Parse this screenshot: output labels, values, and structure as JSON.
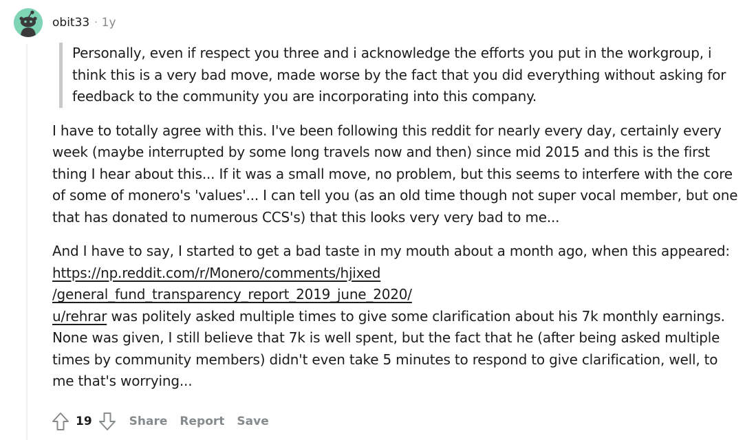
{
  "comment": {
    "username": "obit33",
    "separator": "·",
    "age": "1y",
    "avatar_icon": "snoo-avatar-icon",
    "avatar_color": "#7ed4b5",
    "quote": "Personally, even if respect you three and i acknowledge the efforts you put in the workgroup, i think this is a very bad move, made worse by the fact that you did everything without asking for feedback to the community you are incorporating into this company.",
    "paragraph1": "I have to totally agree with this. I've been following this reddit for nearly every day, certainly every week (maybe interrupted by some long travels now and then) since mid 2015 and this is the first thing I hear about this... If it was a small move, no problem, but this seems to interfere with the core of some of monero's 'values'... I can tell you (as an old time though not super vocal member, but one that has donated to numerous CCS's) that this looks very very bad to me...",
    "paragraph2_intro": "And I have to say, I started to get a bad taste in my mouth about a month ago, when this appeared:",
    "link_line1": "https://np.reddit.com/r/Monero/comments/hjixed",
    "link_line2": "/general_fund_transparency_report_2019_june_2020/",
    "user_link": "u/rehrar",
    "paragraph2_rest": " was politely asked multiple times to give some clarification about his 7k monthly earnings. None was given, I still believe that 7k is well spent, but the fact that he (after being asked multiple times by community members) didn't even take 5 minutes to respond to give clarification, well, to me that's worrying..."
  },
  "actions": {
    "upvote_icon": "arrow-up-icon",
    "score": "19",
    "downvote_icon": "arrow-down-icon",
    "share_label": "Share",
    "report_label": "Report",
    "save_label": "Save"
  }
}
